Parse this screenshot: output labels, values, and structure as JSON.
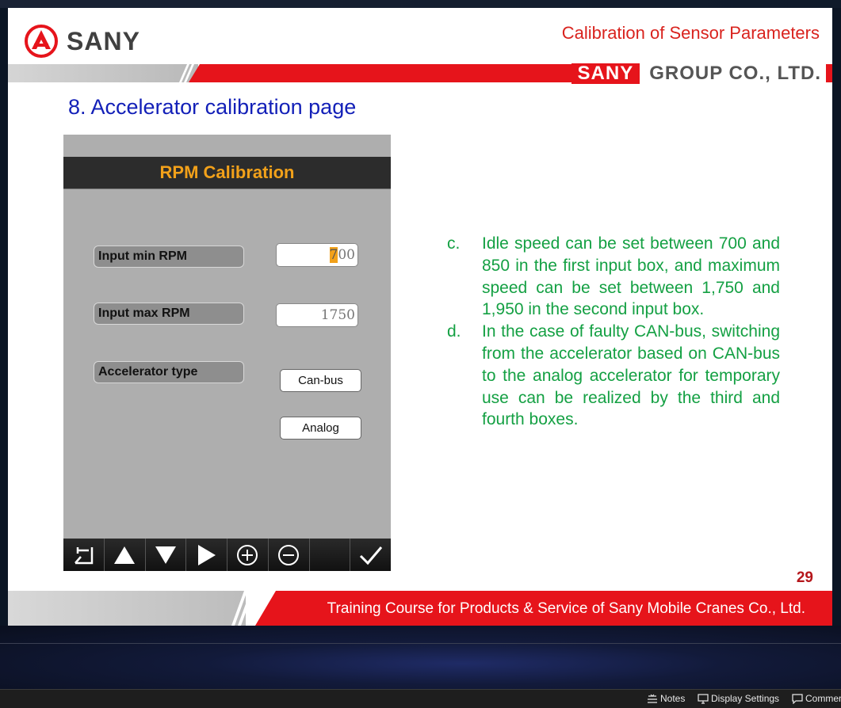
{
  "header": {
    "logo_text": "SANY",
    "slide_title": "Calibration of Sensor Parameters",
    "company_brand": "SANY",
    "company_rest": "GROUP  CO., LTD."
  },
  "heading": "8. Accelerator calibration page",
  "device": {
    "title": "RPM Calibration",
    "fields": [
      {
        "label": "Input min RPM",
        "value_highlight": "7",
        "value_rest": "00"
      },
      {
        "label": "Input max RPM",
        "value": "1750"
      },
      {
        "label": "Accelerator type"
      }
    ],
    "buttons": {
      "canbus": "Can-bus",
      "analog": "Analog"
    },
    "toolbar": [
      "back-icon",
      "up-arrow-icon",
      "down-arrow-icon",
      "right-arrow-icon",
      "plus-icon",
      "minus-icon",
      "blank",
      "check-icon"
    ]
  },
  "notes": [
    {
      "label": "c.",
      "text": "Idle speed can be set between 700 and 850 in the first input box, and maximum speed can be set between 1,750 and 1,950 in the second input box."
    },
    {
      "label": "d.",
      "text": "In the case of faulty CAN-bus, switching from the accelerator based on CAN-bus to the analog accelerator for temporary use can be realized by the third and fourth boxes."
    }
  ],
  "page_number": "29",
  "footer": "Training Course for Products & Service of Sany Mobile Cranes Co., Ltd.",
  "statusbar": {
    "notes": "Notes",
    "display_settings": "Display Settings",
    "comments": "Commen"
  },
  "colors": {
    "brand_red": "#e6141b",
    "heading_blue": "#1320b8",
    "note_green": "#14a043",
    "device_title": "#f2a11a"
  }
}
